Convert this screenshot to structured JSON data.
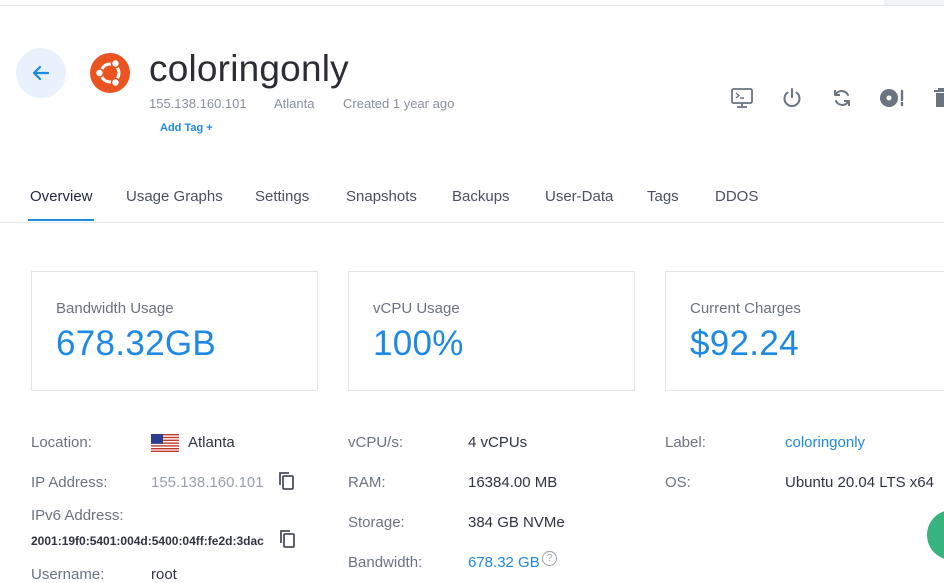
{
  "server": {
    "name": "coloringonly",
    "ip": "155.138.160.101",
    "location": "Atlanta",
    "created": "Created 1 year ago",
    "add_tag": "Add Tag +"
  },
  "actions": [
    {
      "icon": "console-icon"
    },
    {
      "icon": "power-icon"
    },
    {
      "icon": "restart-icon"
    },
    {
      "icon": "iso-icon"
    },
    {
      "icon": "trash-icon"
    }
  ],
  "tabs": [
    "Overview",
    "Usage Graphs",
    "Settings",
    "Snapshots",
    "Backups",
    "User-Data",
    "Tags",
    "DDOS"
  ],
  "cards": [
    {
      "label": "Bandwidth Usage",
      "value": "678.32GB"
    },
    {
      "label": "vCPU Usage",
      "value": "100%"
    },
    {
      "label": "Current Charges",
      "value": "$92.24"
    }
  ],
  "info": {
    "location_label": "Location:",
    "location_value": "Atlanta",
    "ip_label": "IP Address:",
    "ip_value": "155.138.160.101",
    "ipv6_label": "IPv6 Address:",
    "ipv6_value": "2001:19f0:5401:004d:5400:04ff:fe2d:3dac",
    "username_label": "Username:",
    "username_value": "root",
    "vcpu_label": "vCPU/s:",
    "vcpu_value": "4 vCPUs",
    "ram_label": "RAM:",
    "ram_value": "16384.00 MB",
    "storage_label": "Storage:",
    "storage_value": "384 GB NVMe",
    "bandwidth_label": "Bandwidth:",
    "bandwidth_value": "678.32 GB",
    "help": "?",
    "label_label": "Label:",
    "label_value": "coloringonly",
    "os_label": "OS:",
    "os_value": "Ubuntu 20.04 LTS x64"
  },
  "colors": {
    "accent": "#1e88e5",
    "ubuntu": "#e95420"
  }
}
